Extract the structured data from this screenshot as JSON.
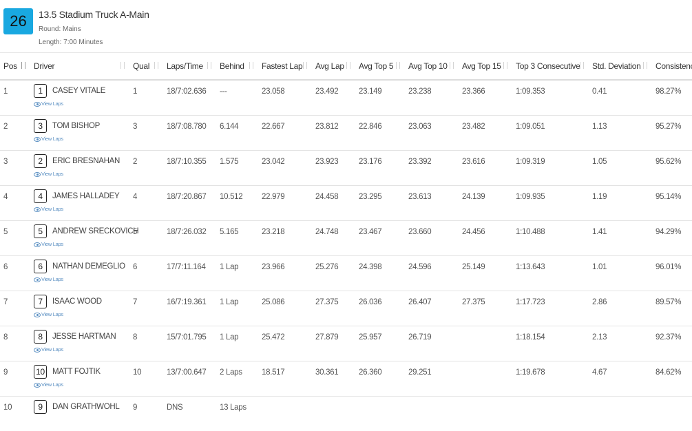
{
  "race": {
    "number": "26",
    "title": "13.5 Stadium Truck A-Main",
    "round": "Round: Mains",
    "length": "Length: 7:00 Minutes"
  },
  "columns": [
    "Pos",
    "Driver",
    "Qual",
    "Laps/Time",
    "Behind",
    "Fastest Lap",
    "Avg Lap",
    "Avg Top 5",
    "Avg Top 10",
    "Avg Top 15",
    "Top 3 Consecutive",
    "Std. Deviation",
    "Consistency"
  ],
  "view_laps_label": "View Laps",
  "rows": [
    {
      "pos": "1",
      "car": "1",
      "name": "CASEY VITALE",
      "qual": "1",
      "laps": "18/7:02.636",
      "behind": "---",
      "fastest": "23.058",
      "avg": "23.492",
      "top5": "23.149",
      "top10": "23.238",
      "top15": "23.366",
      "top3c": "1:09.353",
      "std": "0.41",
      "cons": "98.27%"
    },
    {
      "pos": "2",
      "car": "3",
      "name": "TOM BISHOP",
      "qual": "3",
      "laps": "18/7:08.780",
      "behind": "6.144",
      "fastest": "22.667",
      "avg": "23.812",
      "top5": "22.846",
      "top10": "23.063",
      "top15": "23.482",
      "top3c": "1:09.051",
      "std": "1.13",
      "cons": "95.27%"
    },
    {
      "pos": "3",
      "car": "2",
      "name": "ERIC BRESNAHAN",
      "qual": "2",
      "laps": "18/7:10.355",
      "behind": "1.575",
      "fastest": "23.042",
      "avg": "23.923",
      "top5": "23.176",
      "top10": "23.392",
      "top15": "23.616",
      "top3c": "1:09.319",
      "std": "1.05",
      "cons": "95.62%"
    },
    {
      "pos": "4",
      "car": "4",
      "name": "JAMES HALLADEY",
      "qual": "4",
      "laps": "18/7:20.867",
      "behind": "10.512",
      "fastest": "22.979",
      "avg": "24.458",
      "top5": "23.295",
      "top10": "23.613",
      "top15": "24.139",
      "top3c": "1:09.935",
      "std": "1.19",
      "cons": "95.14%"
    },
    {
      "pos": "5",
      "car": "5",
      "name": "ANDREW SRECKOVICH",
      "qual": "5",
      "laps": "18/7:26.032",
      "behind": "5.165",
      "fastest": "23.218",
      "avg": "24.748",
      "top5": "23.467",
      "top10": "23.660",
      "top15": "24.456",
      "top3c": "1:10.488",
      "std": "1.41",
      "cons": "94.29%"
    },
    {
      "pos": "6",
      "car": "6",
      "name": "NATHAN DEMEGLIO",
      "qual": "6",
      "laps": "17/7:11.164",
      "behind": "1 Lap",
      "fastest": "23.966",
      "avg": "25.276",
      "top5": "24.398",
      "top10": "24.596",
      "top15": "25.149",
      "top3c": "1:13.643",
      "std": "1.01",
      "cons": "96.01%"
    },
    {
      "pos": "7",
      "car": "7",
      "name": "ISAAC WOOD",
      "qual": "7",
      "laps": "16/7:19.361",
      "behind": "1 Lap",
      "fastest": "25.086",
      "avg": "27.375",
      "top5": "26.036",
      "top10": "26.407",
      "top15": "27.375",
      "top3c": "1:17.723",
      "std": "2.86",
      "cons": "89.57%"
    },
    {
      "pos": "8",
      "car": "8",
      "name": "JESSE HARTMAN",
      "qual": "8",
      "laps": "15/7:01.795",
      "behind": "1 Lap",
      "fastest": "25.472",
      "avg": "27.879",
      "top5": "25.957",
      "top10": "26.719",
      "top15": "",
      "top3c": "1:18.154",
      "std": "2.13",
      "cons": "92.37%"
    },
    {
      "pos": "9",
      "car": "10",
      "name": "MATT FOJTIK",
      "qual": "10",
      "laps": "13/7:00.647",
      "behind": "2 Laps",
      "fastest": "18.517",
      "avg": "30.361",
      "top5": "26.360",
      "top10": "29.251",
      "top15": "",
      "top3c": "1:19.678",
      "std": "4.67",
      "cons": "84.62%"
    },
    {
      "pos": "10",
      "car": "9",
      "name": "DAN GRATHWOHL",
      "qual": "9",
      "laps": "DNS",
      "behind": "13 Laps",
      "fastest": "",
      "avg": "",
      "top5": "",
      "top10": "",
      "top15": "",
      "top3c": "",
      "std": "",
      "cons": ""
    }
  ]
}
